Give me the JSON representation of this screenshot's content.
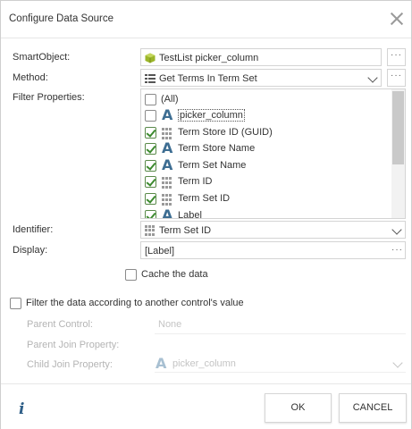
{
  "dialog": {
    "title": "Configure Data Source"
  },
  "form": {
    "smartobject_label": "SmartObject:",
    "smartobject_value": "TestList picker_column",
    "method_label": "Method:",
    "method_value": "Get Terms In Term Set",
    "filter_label": "Filter Properties:",
    "identifier_label": "Identifier:",
    "identifier_value": "Term Set ID",
    "display_label": "Display:",
    "display_value": "[Label]",
    "ellipsis": "···"
  },
  "filter_properties": [
    {
      "label": "(All)",
      "checked": false,
      "icon": "none"
    },
    {
      "label": "picker_column",
      "checked": false,
      "icon": "text-type-icon"
    },
    {
      "label": "Term Store ID (GUID)",
      "checked": true,
      "icon": "guid-grid-icon"
    },
    {
      "label": "Term Store Name",
      "checked": true,
      "icon": "text-type-icon"
    },
    {
      "label": "Term Set Name",
      "checked": true,
      "icon": "text-type-icon"
    },
    {
      "label": "Term ID",
      "checked": true,
      "icon": "guid-grid-icon"
    },
    {
      "label": "Term Set ID",
      "checked": true,
      "icon": "guid-grid-icon"
    },
    {
      "label": "Label",
      "checked": true,
      "icon": "text-type-icon"
    }
  ],
  "cache": {
    "label": "Cache the data",
    "checked": false
  },
  "filter_other": {
    "label": "Filter the data according to another control's value",
    "checked": false,
    "parent_control_label": "Parent Control:",
    "parent_control_value": "None",
    "parent_join_label": "Parent Join Property:",
    "child_join_label": "Child Join Property:",
    "child_join_value": "picker_column"
  },
  "footer": {
    "info": "i",
    "ok": "OK",
    "cancel": "CANCEL"
  },
  "colors": {
    "accent": "#3d6d92",
    "check": "#3c8a2e",
    "smartobject_icon": "#8aa61e"
  }
}
